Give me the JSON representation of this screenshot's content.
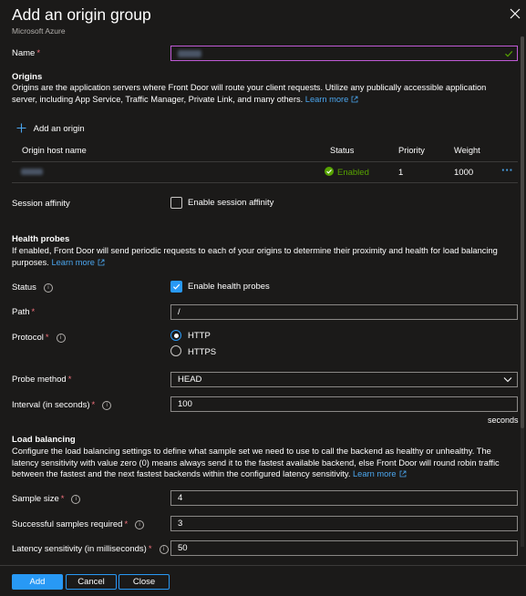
{
  "header": {
    "title": "Add an origin group",
    "subtitle": "Microsoft Azure"
  },
  "name_field": {
    "label": "Name",
    "required": "*"
  },
  "origins": {
    "title": "Origins",
    "description": "Origins are the application servers where Front Door will route your client requests. Utilize any publically accessible application server, including App Service, Traffic Manager, Private Link, and many others.",
    "learn_more": "Learn more",
    "add_label": "Add an origin",
    "columns": [
      "Origin host name",
      "Status",
      "Priority",
      "Weight"
    ],
    "rows": [
      {
        "status": "Enabled",
        "priority": "1",
        "weight": "1000",
        "more": "···"
      }
    ]
  },
  "session_affinity": {
    "label": "Session affinity",
    "checkbox_label": "Enable session affinity",
    "checked": false
  },
  "health_probes": {
    "title": "Health probes",
    "description": "If enabled, Front Door will send periodic requests to each of your origins to determine their proximity and health for load balancing purposes.",
    "learn_more": "Learn more",
    "status_label": "Status",
    "status_checkbox_label": "Enable health probes",
    "status_checked": true,
    "path_label": "Path",
    "path_value": "/",
    "protocol_label": "Protocol",
    "protocol_options": [
      "HTTP",
      "HTTPS"
    ],
    "protocol_selected": "HTTP",
    "probe_method_label": "Probe method",
    "probe_method_value": "HEAD",
    "interval_label": "Interval (in seconds)",
    "interval_value": "100",
    "interval_unit": "seconds"
  },
  "load_balancing": {
    "title": "Load balancing",
    "description": "Configure the load balancing settings to define what sample set we need to use to call the backend as healthy or unhealthy. The latency sensitivity with value zero (0) means always send it to the fastest available backend, else Front Door will round robin traffic between the fastest and the next fastest backends within the configured latency sensitivity.",
    "learn_more": "Learn more",
    "sample_size_label": "Sample size",
    "sample_size_value": "4",
    "successful_label": "Successful samples required",
    "successful_value": "3",
    "latency_label": "Latency sensitivity (in milliseconds)",
    "latency_value": "50"
  },
  "required_mark": "*",
  "footer": {
    "add": "Add",
    "cancel": "Cancel",
    "close": "Close"
  },
  "colors": {
    "accent": "#2899f5",
    "success": "#57a300",
    "link": "#4ba6ee",
    "required": "#f1707b"
  }
}
